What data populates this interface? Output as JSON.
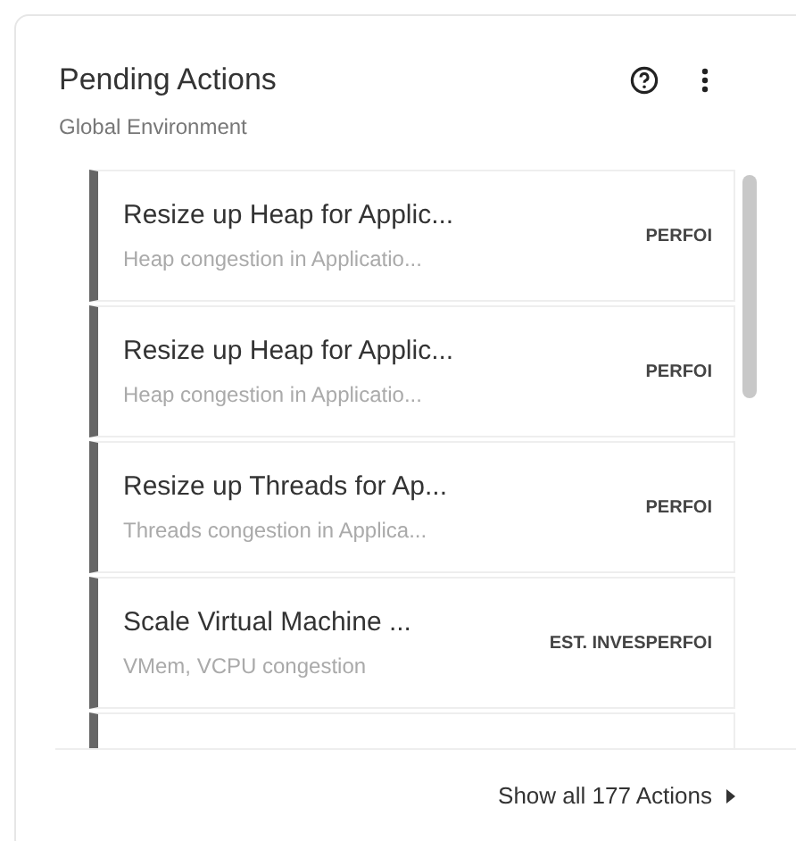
{
  "card": {
    "title": "Pending Actions",
    "subtitle": "Global Environment"
  },
  "actions": [
    {
      "title": "Resize up Heap for Applic...",
      "description": "Heap congestion in Applicatio...",
      "tag": "PERFOI"
    },
    {
      "title": "Resize up Heap for Applic...",
      "description": "Heap congestion in Applicatio...",
      "tag": "PERFOI"
    },
    {
      "title": "Resize up Threads for Ap...",
      "description": "Threads congestion in Applica...",
      "tag": "PERFOI"
    },
    {
      "title": "Scale Virtual Machine ...",
      "description": "VMem, VCPU congestion",
      "tag": "EST. INVESPERFOI"
    }
  ],
  "footer": {
    "link": "Show all 177 Actions"
  }
}
